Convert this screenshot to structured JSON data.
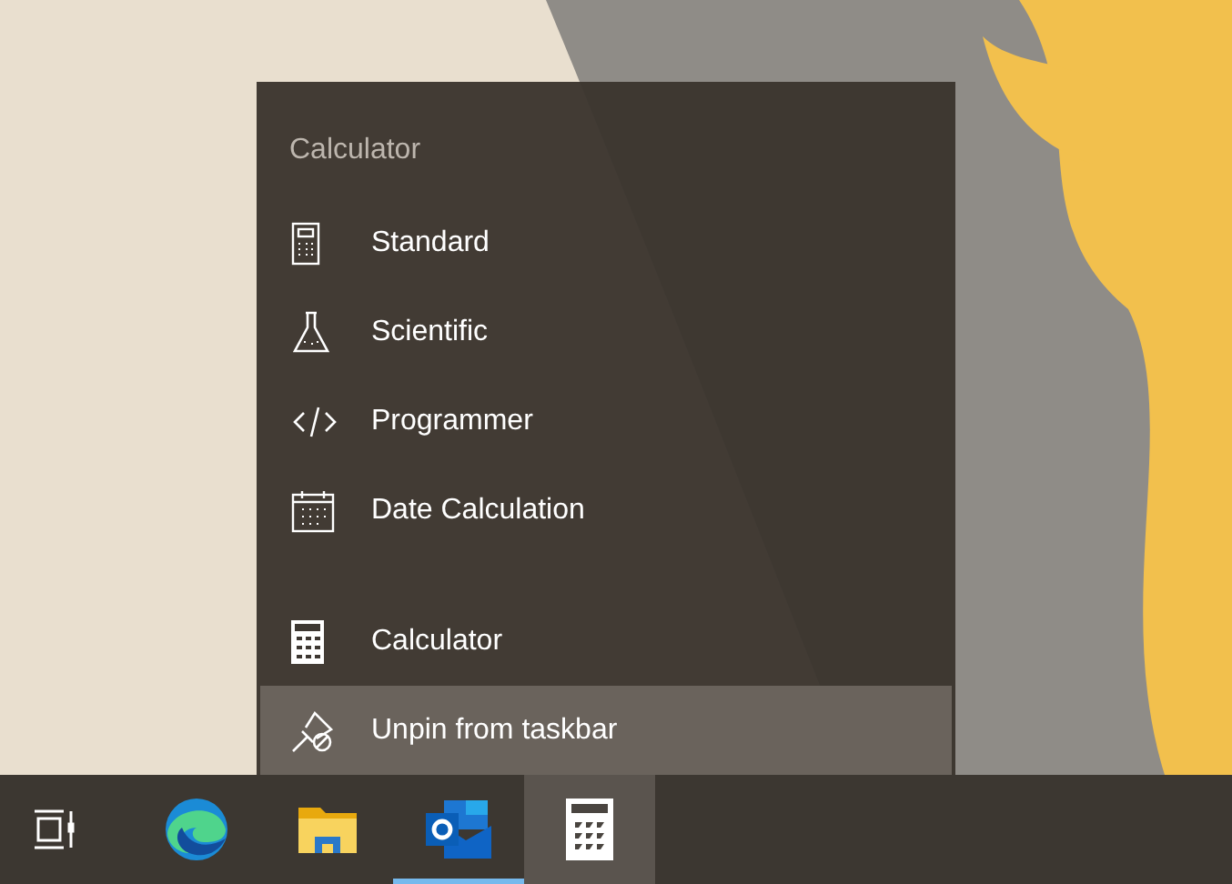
{
  "jump_list": {
    "title": "Calculator",
    "modes": [
      {
        "kind": "standard",
        "label": "Standard"
      },
      {
        "kind": "scientific",
        "label": "Scientific"
      },
      {
        "kind": "programmer",
        "label": "Programmer"
      },
      {
        "kind": "date",
        "label": "Date Calculation"
      }
    ],
    "actions": [
      {
        "kind": "app",
        "label": "Calculator",
        "hovered": false
      },
      {
        "kind": "unpin",
        "label": "Unpin from taskbar",
        "hovered": true
      }
    ]
  },
  "taskbar": {
    "items": [
      {
        "kind": "task-view",
        "selected": false,
        "running": false
      },
      {
        "kind": "edge",
        "selected": false,
        "running": false
      },
      {
        "kind": "explorer",
        "selected": false,
        "running": false
      },
      {
        "kind": "outlook",
        "selected": false,
        "running": true
      },
      {
        "kind": "calculator",
        "selected": true,
        "running": false
      }
    ]
  }
}
